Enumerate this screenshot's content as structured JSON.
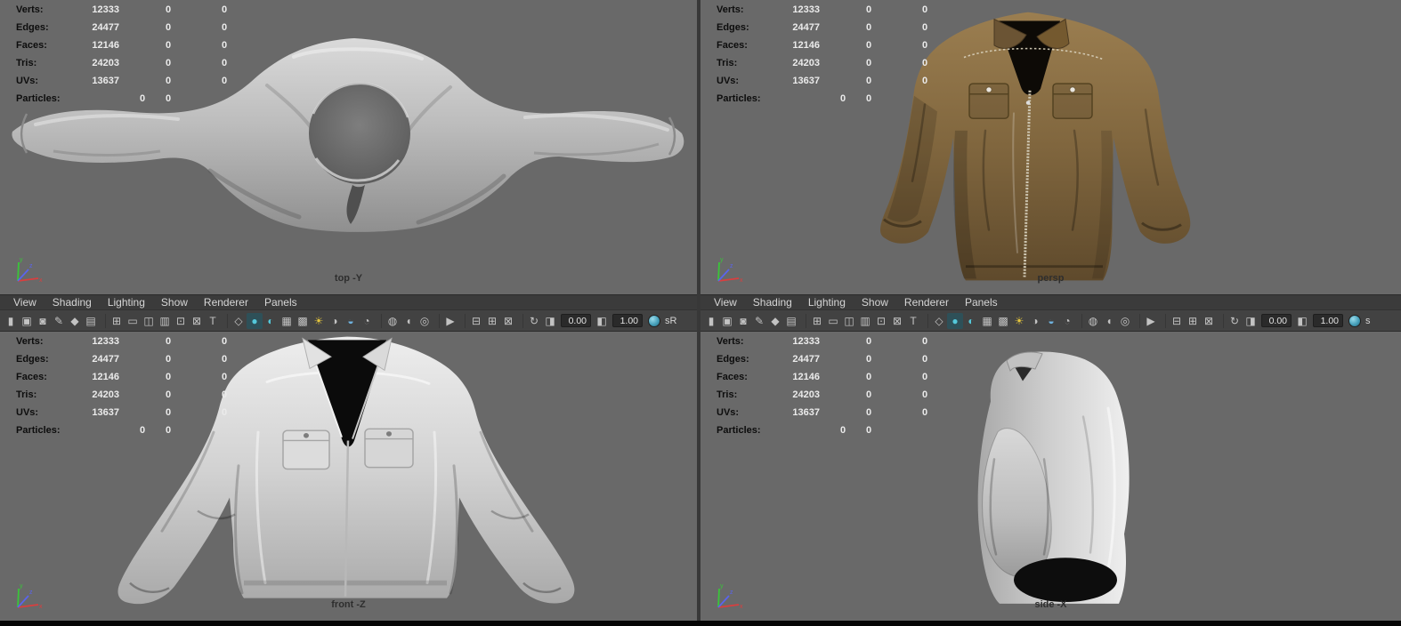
{
  "stats": {
    "rows": [
      {
        "label": "Verts:",
        "v1": "12333",
        "v2": "0",
        "v3": "0"
      },
      {
        "label": "Edges:",
        "v1": "24477",
        "v2": "0",
        "v3": "0"
      },
      {
        "label": "Faces:",
        "v1": "12146",
        "v2": "0",
        "v3": "0"
      },
      {
        "label": "Tris:",
        "v1": "24203",
        "v2": "0",
        "v3": "0"
      },
      {
        "label": "UVs:",
        "v1": "13637",
        "v2": "0",
        "v3": "0"
      },
      {
        "label": "Particles:",
        "v1": "0",
        "v2": "0",
        "v3": "",
        "particles": true
      }
    ]
  },
  "menus": [
    "View",
    "Shading",
    "Lighting",
    "Show",
    "Renderer",
    "Panels"
  ],
  "toolbar": {
    "icons": [
      {
        "name": "panel-handle",
        "glyph": "▮"
      },
      {
        "name": "select-camera",
        "glyph": "▣"
      },
      {
        "name": "lock-camera",
        "glyph": "◙"
      },
      {
        "name": "camera-attributes",
        "glyph": "✎"
      },
      {
        "name": "bookmark",
        "glyph": "◆"
      },
      {
        "name": "image-plane",
        "glyph": "▤"
      },
      {
        "name": "sep"
      },
      {
        "name": "grid",
        "glyph": "⊞"
      },
      {
        "name": "film-gate",
        "glyph": "▭"
      },
      {
        "name": "resolution-gate",
        "glyph": "◫"
      },
      {
        "name": "gate-mask",
        "glyph": "▥"
      },
      {
        "name": "field-chart",
        "glyph": "⊡"
      },
      {
        "name": "safe-action",
        "glyph": "⊠"
      },
      {
        "name": "safe-title",
        "glyph": "T"
      },
      {
        "name": "sep"
      },
      {
        "name": "wireframe-mode",
        "glyph": "◇"
      },
      {
        "name": "shaded-mode",
        "glyph": "●",
        "color": "#54c8da",
        "active": true
      },
      {
        "name": "textured-mode",
        "glyph": "◐",
        "color": "#54c8da"
      },
      {
        "name": "material-checker",
        "glyph": "▦"
      },
      {
        "name": "wireframe-on-shaded",
        "glyph": "▩"
      },
      {
        "name": "lights",
        "glyph": "☀",
        "color": "#e5c63e"
      },
      {
        "name": "shadows",
        "glyph": "◑"
      },
      {
        "name": "screen-space-ao",
        "glyph": "◒",
        "color": "#6fb3e0"
      },
      {
        "name": "motion-blur",
        "glyph": "◔"
      },
      {
        "name": "sep"
      },
      {
        "name": "xray",
        "glyph": "◍"
      },
      {
        "name": "backface-culling",
        "glyph": "◖"
      },
      {
        "name": "isolate-select",
        "glyph": "◎"
      },
      {
        "name": "sep"
      },
      {
        "name": "select-highlight",
        "glyph": "▶"
      },
      {
        "name": "sep"
      },
      {
        "name": "split-horizontal",
        "glyph": "⊟"
      },
      {
        "name": "split-grid",
        "glyph": "⊞"
      },
      {
        "name": "maximize-pane",
        "glyph": "⊠"
      },
      {
        "name": "sep"
      },
      {
        "name": "refresh-view",
        "glyph": "↻"
      },
      {
        "name": "exposure-toggle",
        "glyph": "◨"
      }
    ],
    "icons2": [
      {
        "name": "gamma-toggle",
        "glyph": "◧"
      }
    ],
    "exposure": "0.00",
    "gamma": "1.00",
    "colorspace_left": "sR",
    "colorspace_right": "s",
    "accent_active": "#54c8da"
  },
  "gizmo": {
    "x": "x",
    "y": "y",
    "z": "z"
  },
  "viewports": {
    "top": {
      "label": "top -Y"
    },
    "persp": {
      "label": "persp"
    },
    "front": {
      "label": "front -Z"
    },
    "side": {
      "label": "side -X"
    }
  }
}
